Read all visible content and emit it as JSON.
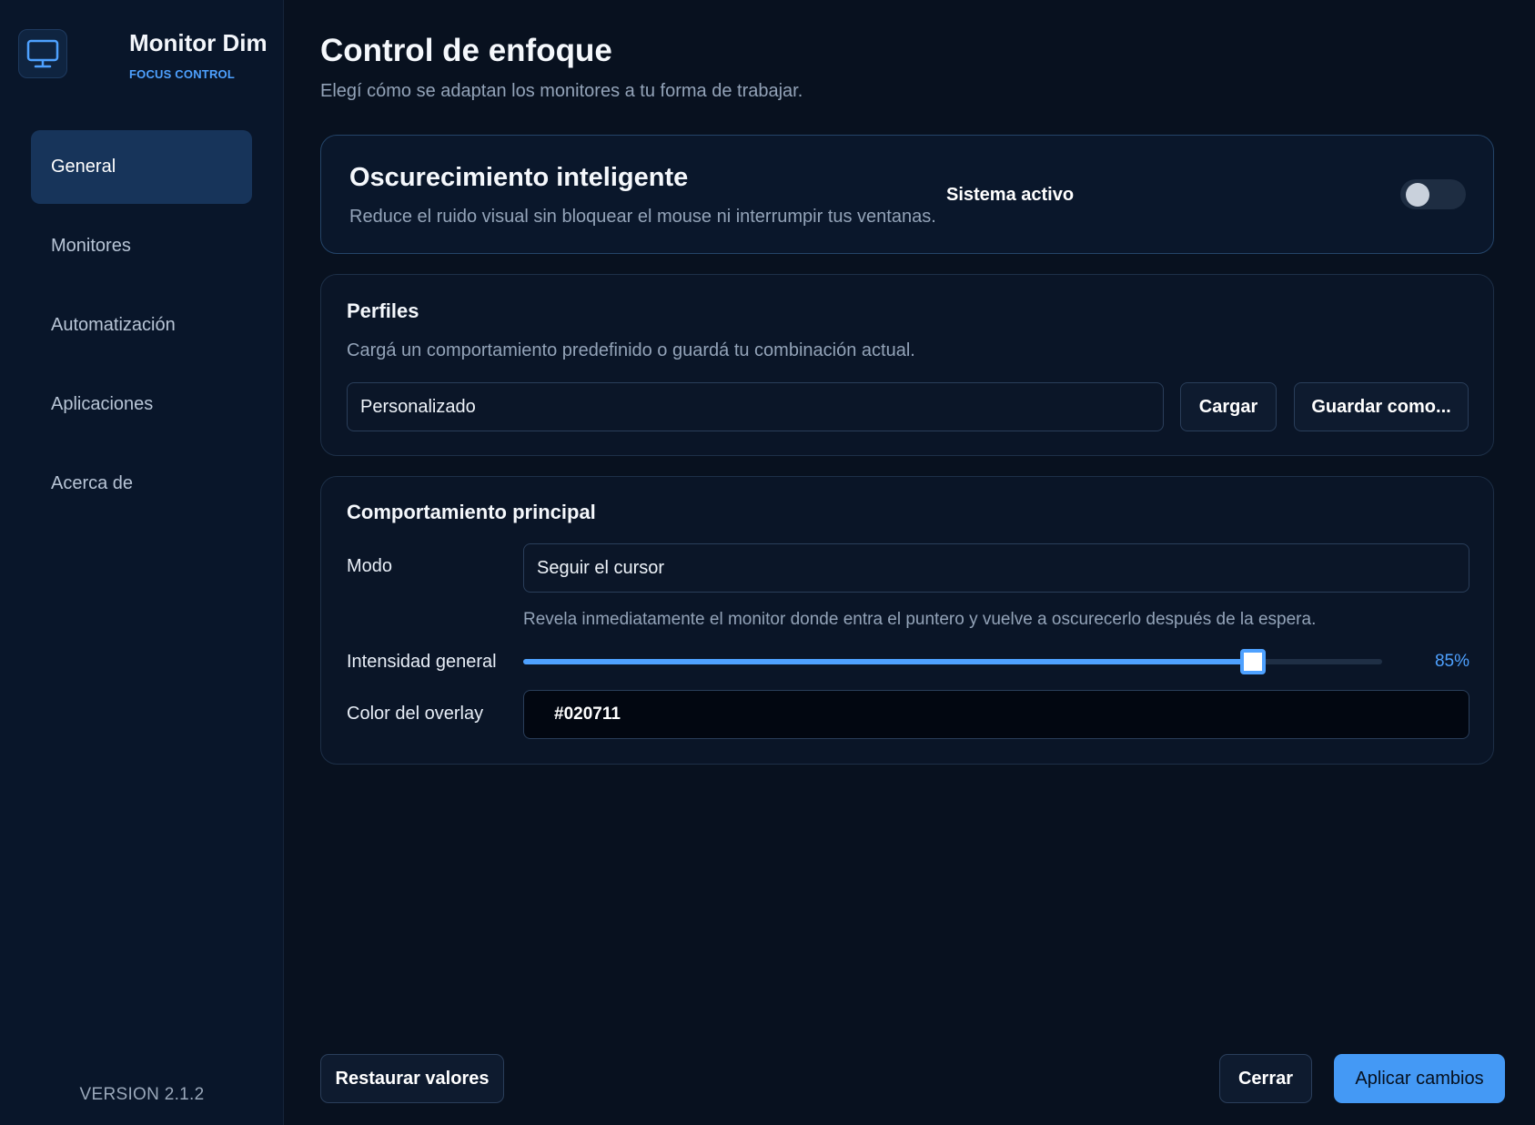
{
  "app": {
    "name": "Monitor Dim",
    "subtitle": "FOCUS CONTROL",
    "version": "VERSION 2.1.2",
    "logo_icon": "monitor-icon"
  },
  "sidebar": {
    "items": [
      {
        "label": "General",
        "active": true
      },
      {
        "label": "Monitores",
        "active": false
      },
      {
        "label": "Automatización",
        "active": false
      },
      {
        "label": "Aplicaciones",
        "active": false
      },
      {
        "label": "Acerca de",
        "active": false
      }
    ]
  },
  "header": {
    "title": "Control de enfoque",
    "subtitle": "Elegí cómo se adaptan los monitores a tu forma de trabajar."
  },
  "smart_dim": {
    "title": "Oscurecimiento inteligente",
    "description": "Reduce el ruido visual sin bloquear el mouse ni interrumpir tus ventanas.",
    "status_label": "Sistema activo",
    "enabled": false
  },
  "profiles": {
    "title": "Perfiles",
    "description": "Cargá un comportamiento predefinido o guardá tu combinación actual.",
    "selected": "Personalizado",
    "load_label": "Cargar",
    "save_as_label": "Guardar como..."
  },
  "behavior": {
    "title": "Comportamiento principal",
    "mode_label": "Modo",
    "mode_value": "Seguir el cursor",
    "mode_help": "Revela inmediatamente el monitor donde entra el puntero y vuelve a oscurecerlo después de la espera.",
    "intensity_label": "Intensidad general",
    "intensity_value": 85,
    "intensity_text": "85%",
    "color_label": "Color del overlay",
    "color_value": "#020711"
  },
  "footer": {
    "reset_label": "Restaurar valores",
    "close_label": "Cerrar",
    "apply_label": "Aplicar cambios"
  },
  "colors": {
    "accent": "#4ea1ff",
    "background": "#08111f",
    "sidebar": "#09162a",
    "active_nav": "#17345a"
  }
}
